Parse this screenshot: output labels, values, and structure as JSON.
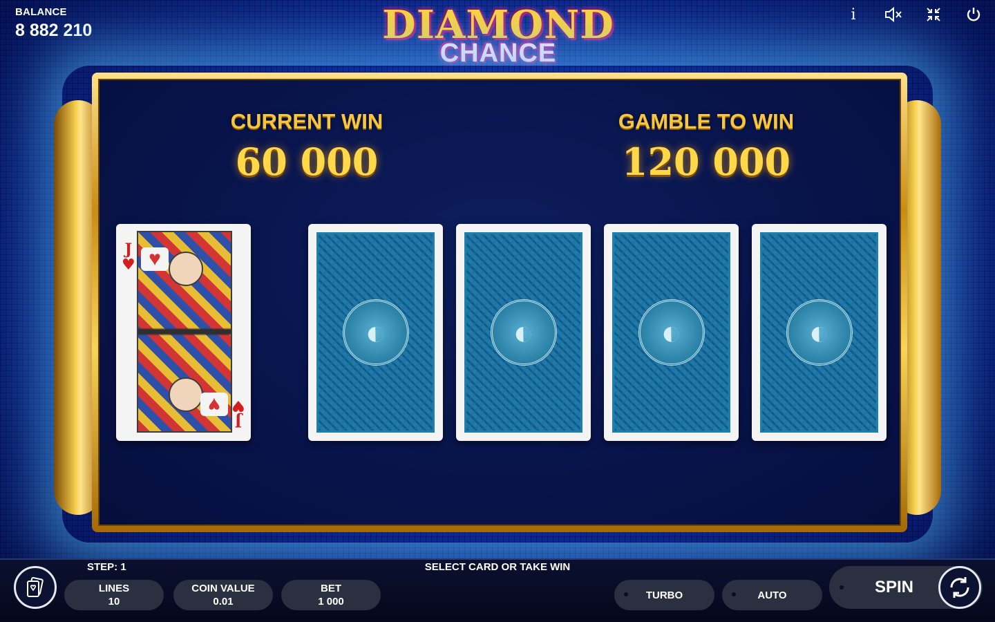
{
  "balance": {
    "label": "BALANCE",
    "value": "8 882 210"
  },
  "logo": {
    "line1": "DIAMOND",
    "line2": "CHANCE"
  },
  "top_icons": [
    {
      "name": "info-icon",
      "glyph": "i"
    },
    {
      "name": "sound-muted-icon",
      "glyph": "🔇"
    },
    {
      "name": "exit-fullscreen-icon",
      "glyph": "⤡"
    },
    {
      "name": "power-icon",
      "glyph": "⏻"
    }
  ],
  "gamble": {
    "current_win_label": "CURRENT WIN",
    "current_win_value": "60 000",
    "gamble_to_win_label": "GAMBLE TO WIN",
    "gamble_to_win_value": "120 000"
  },
  "dealer_card": {
    "rank": "J",
    "suit": "hearts",
    "suit_glyph": "♥"
  },
  "hidden_cards": 4,
  "status": {
    "step": "STEP: 1",
    "message": "SELECT CARD OR TAKE WIN"
  },
  "controls": {
    "lines_label": "LINES",
    "lines_value": "10",
    "coin_value_label": "COIN VALUE",
    "coin_value_value": "0.01",
    "bet_label": "BET",
    "bet_value": "1 000",
    "turbo_label": "TURBO",
    "auto_label": "AUTO",
    "spin_label": "SPIN"
  },
  "colors": {
    "gold": "#f7c640",
    "background": "#0e2e9e",
    "card_back": "#3a98bf",
    "suit_red": "#d41e1e"
  }
}
